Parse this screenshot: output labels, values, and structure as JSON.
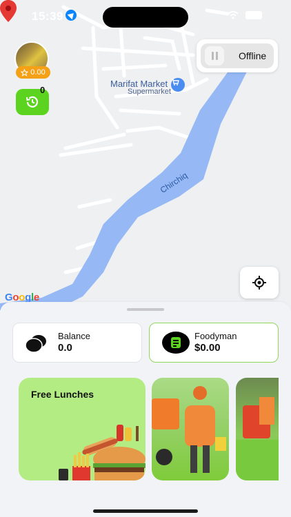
{
  "status_bar": {
    "time": "15:39"
  },
  "driver": {
    "rating": "0.00",
    "history_count": "0"
  },
  "toggle": {
    "label": "Offline"
  },
  "map": {
    "poi_name": "Marifat Market",
    "poi_category": "Supermarket",
    "river_name": "Chirchiq",
    "attribution": "Google",
    "colors": {
      "river": "#96b9f6",
      "land": "#eef0f2",
      "roads": "#ffffff"
    }
  },
  "wallet": {
    "balance": {
      "label": "Balance",
      "value": "0.0"
    },
    "foodyman": {
      "label": "Foodyman",
      "value": "$0.00"
    }
  },
  "promos": [
    {
      "title": "Free Lunches"
    },
    {
      "title": ""
    },
    {
      "title": ""
    }
  ],
  "colors": {
    "accent": "#5cd31e",
    "rating_badge": "#f5a117",
    "promo_bg": "#b4ec84"
  }
}
